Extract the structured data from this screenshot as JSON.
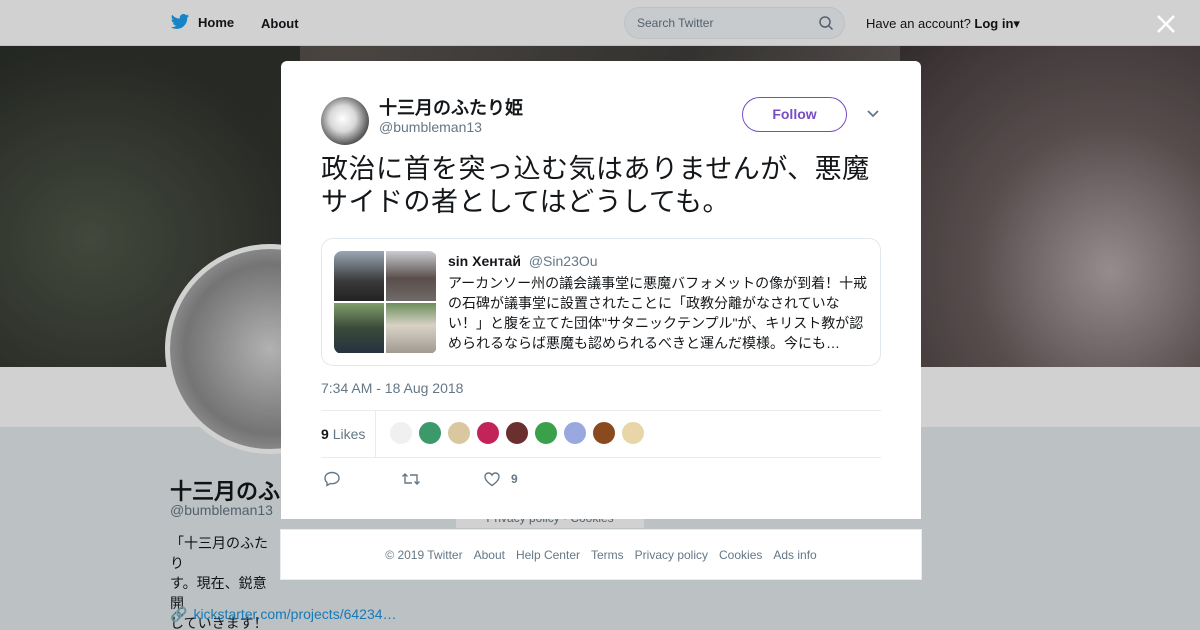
{
  "nav": {
    "home_label": "Home",
    "about_label": "About",
    "search_placeholder": "Search Twitter",
    "have_account": "Have an account?",
    "login_label": "Log in"
  },
  "colors": {
    "brand": "#1da1f2",
    "accent_purple": "#794bc4",
    "link": "#1b95e0",
    "muted": "#657786"
  },
  "background_profile": {
    "name": "十三月のふた",
    "handle": "@bumbleman13",
    "bio_lines": [
      "「十三月のふたり",
      "す。現在、鋭意開",
      "していきます！"
    ],
    "link_text": "kickstarter.com/projects/64234…",
    "footer_links_partial": "Privacy policy · Cookies"
  },
  "tweet": {
    "author_name": "十三月のふたり姫",
    "author_handle": "@bumbleman13",
    "follow_label": "Follow",
    "text": "政治に首を突っ込む気はありませんが、悪魔サイドの者としてはどうしても。",
    "timestamp": "7:34 AM - 18 Aug 2018",
    "likes_count": "9",
    "likes_label": "Likes",
    "like_action_count": "9",
    "quote": {
      "name": "sin Хентай",
      "handle": "@Sin23Ou",
      "text": "アーカンソー州の議会議事堂に悪魔バフォメットの像が到着！十戒の石碑が議事堂に設置されたことに「政教分離がなされていない！」と腹を立てた団体\"サタニックテンプル\"が、キリスト教が認められるならば悪魔も認められるべきと運んだ模様。今にも…"
    }
  },
  "footer": {
    "links": [
      "© 2019 Twitter",
      "About",
      "Help Center",
      "Terms",
      "Privacy policy",
      "Cookies",
      "Ads info"
    ]
  }
}
